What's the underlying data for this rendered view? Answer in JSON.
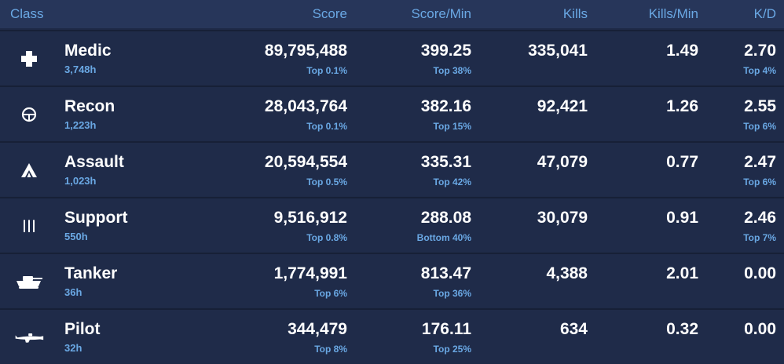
{
  "headers": {
    "class": "Class",
    "score": "Score",
    "score_min": "Score/Min",
    "kills": "Kills",
    "kills_min": "Kills/Min",
    "kd": "K/D"
  },
  "colors": {
    "background": "#1e2a47",
    "header_bg": "#27365a",
    "accent": "#6aa8e4",
    "text": "#ffffff"
  },
  "rows": [
    {
      "icon": "medic-cross-icon",
      "name": "Medic",
      "hours": "3,748h",
      "score": "89,795,488",
      "score_rank": "Top 0.1%",
      "score_min": "399.25",
      "score_min_rank": "Top 38%",
      "kills": "335,041",
      "kills_min": "1.49",
      "kd": "2.70",
      "kd_rank": "Top 4%"
    },
    {
      "icon": "recon-scope-icon",
      "name": "Recon",
      "hours": "1,223h",
      "score": "28,043,764",
      "score_rank": "Top 0.1%",
      "score_min": "382.16",
      "score_min_rank": "Top 15%",
      "kills": "92,421",
      "kills_min": "1.26",
      "kd": "2.55",
      "kd_rank": "Top 6%"
    },
    {
      "icon": "assault-chevron-icon",
      "name": "Assault",
      "hours": "1,023h",
      "score": "20,594,554",
      "score_rank": "Top 0.5%",
      "score_min": "335.31",
      "score_min_rank": "Top 42%",
      "kills": "47,079",
      "kills_min": "0.77",
      "kd": "2.47",
      "kd_rank": "Top 6%"
    },
    {
      "icon": "support-ammo-icon",
      "name": "Support",
      "hours": "550h",
      "score": "9,516,912",
      "score_rank": "Top 0.8%",
      "score_min": "288.08",
      "score_min_rank": "Bottom 40%",
      "kills": "30,079",
      "kills_min": "0.91",
      "kd": "2.46",
      "kd_rank": "Top 7%"
    },
    {
      "icon": "tank-icon",
      "name": "Tanker",
      "hours": "36h",
      "score": "1,774,991",
      "score_rank": "Top 6%",
      "score_min": "813.47",
      "score_min_rank": "Top 36%",
      "kills": "4,388",
      "kills_min": "2.01",
      "kd": "0.00",
      "kd_rank": ""
    },
    {
      "icon": "plane-icon",
      "name": "Pilot",
      "hours": "32h",
      "score": "344,479",
      "score_rank": "Top 8%",
      "score_min": "176.11",
      "score_min_rank": "Top 25%",
      "kills": "634",
      "kills_min": "0.32",
      "kd": "0.00",
      "kd_rank": ""
    }
  ]
}
